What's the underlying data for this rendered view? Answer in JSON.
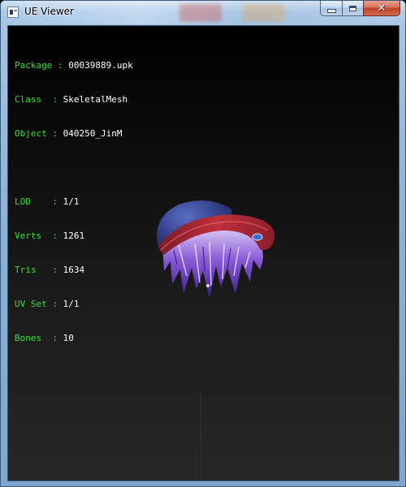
{
  "window": {
    "title": "UE Viewer",
    "icon": "ue-viewer-app-icon",
    "buttons": {
      "minimize": "minimize-icon",
      "maximize": "maximize-icon",
      "close_glyph": "✕"
    }
  },
  "info": {
    "rows": [
      {
        "key": "Package",
        "value": "00039889.upk"
      },
      {
        "key": "Class  ",
        "value": "SkeletalMesh"
      },
      {
        "key": "Object ",
        "value": "040250_JinM"
      }
    ],
    "stats": [
      {
        "key": "LOD    ",
        "value": "1/1"
      },
      {
        "key": "Verts  ",
        "value": "1261"
      },
      {
        "key": "Tris   ",
        "value": "1634"
      },
      {
        "key": "UV Set ",
        "value": "1/1"
      },
      {
        "key": "Bones  ",
        "value": "10"
      }
    ]
  },
  "colors": {
    "label_green": "#2ee62e",
    "value_white": "#ffffff",
    "viewport_top": "#000000",
    "viewport_bottom": "#272727",
    "axis_blue": "#1e1eb4",
    "cap_blue": "#3c4d9c",
    "cap_brim_red": "#c0303a",
    "hair_purple": "#8a5ad8"
  },
  "viewport": {
    "model": "skeletal-mesh-hat-and-hair"
  }
}
